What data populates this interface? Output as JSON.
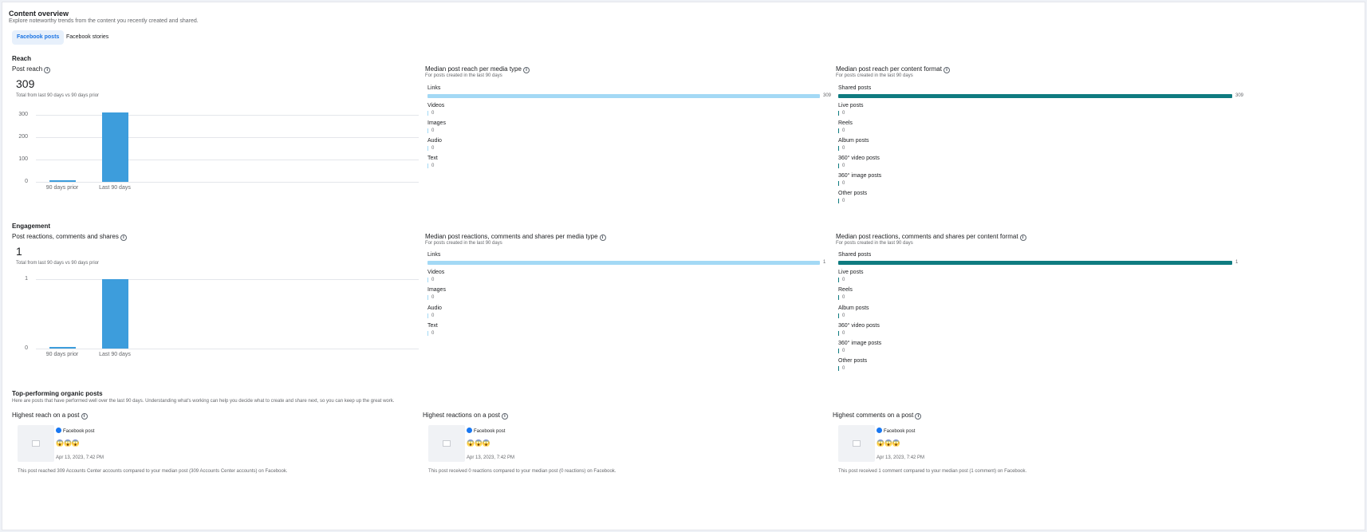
{
  "header": {
    "title": "Content overview",
    "subtitle": "Explore noteworthy trends from the content you recently created and shared."
  },
  "tabs": [
    {
      "label": "Facebook posts",
      "active": true
    },
    {
      "label": "Facebook stories",
      "active": false
    }
  ],
  "reach": {
    "section_title": "Reach",
    "post_reach": {
      "title": "Post reach",
      "total": "309",
      "caption": "Total from last 90 days vs 90 days prior",
      "chart_data": {
        "type": "bar",
        "categories": [
          "90 days prior",
          "Last 90 days"
        ],
        "values": [
          4,
          309
        ],
        "ylim": [
          0,
          309
        ],
        "yticks": [
          "300",
          "200",
          "100",
          "0"
        ],
        "ytick_values": [
          300,
          200,
          100,
          0
        ],
        "color": "#3d9ddc"
      }
    },
    "media_type": {
      "title": "Median post reach per media type",
      "caption": "For posts created in the last 90 days",
      "chart_data": {
        "type": "bar",
        "color": "#a3d9f5",
        "max": 309,
        "categories": [
          "Links",
          "Videos",
          "Images",
          "Audio",
          "Text"
        ],
        "values": [
          309,
          0,
          0,
          0,
          0
        ],
        "value_labels": [
          "309",
          "0",
          "0",
          "0",
          "0"
        ]
      }
    },
    "content_format": {
      "title": "Median post reach per content format",
      "caption": "For posts created in the last 90 days",
      "chart_data": {
        "type": "bar",
        "color": "#0f7b80",
        "max": 309,
        "categories": [
          "Shared posts",
          "Live posts",
          "Reels",
          "Album posts",
          "360° video posts",
          "360° image posts",
          "Other posts"
        ],
        "values": [
          309,
          0,
          0,
          0,
          0,
          0,
          0
        ],
        "value_labels": [
          "309",
          "0",
          "0",
          "0",
          "0",
          "0",
          "0"
        ]
      }
    }
  },
  "engagement": {
    "section_title": "Engagement",
    "post_engagement": {
      "title": "Post reactions, comments and shares",
      "total": "1",
      "caption": "Total from last 90 days vs 90 days prior",
      "chart_data": {
        "type": "bar",
        "categories": [
          "90 days prior",
          "Last 90 days"
        ],
        "values": [
          0.02,
          1
        ],
        "ylim": [
          0,
          1
        ],
        "yticks": [
          "1",
          "0"
        ],
        "ytick_values": [
          1,
          0
        ],
        "color": "#3d9ddc"
      }
    },
    "media_type": {
      "title": "Median post reactions, comments and shares per media type",
      "caption": "For posts created in the last 90 days",
      "chart_data": {
        "type": "bar",
        "color": "#a3d9f5",
        "max": 1,
        "categories": [
          "Links",
          "Videos",
          "Images",
          "Audio",
          "Text"
        ],
        "values": [
          1,
          0,
          0,
          0,
          0
        ],
        "value_labels": [
          "1",
          "0",
          "0",
          "0",
          "0"
        ]
      }
    },
    "content_format": {
      "title": "Median post reactions, comments and shares per content format",
      "caption": "For posts created in the last 90 days",
      "chart_data": {
        "type": "bar",
        "color": "#0f7b80",
        "max": 1,
        "categories": [
          "Shared posts",
          "Live posts",
          "Reels",
          "Album posts",
          "360° video posts",
          "360° image posts",
          "Other posts"
        ],
        "values": [
          1,
          0,
          0,
          0,
          0,
          0,
          0
        ],
        "value_labels": [
          "1",
          "0",
          "0",
          "0",
          "0",
          "0",
          "0"
        ]
      }
    }
  },
  "top_posts": {
    "title": "Top-performing organic posts",
    "subtitle": "Here are posts that have performed well over the last 90 days. Understanding what's working can help you decide what to create and share next, so you can keep up the great work.",
    "cards": [
      {
        "title": "Highest reach on a post",
        "post_type": "Facebook post",
        "emoji": "😱😱😱",
        "date": "Apr 13, 2023, 7:42 PM",
        "description": "This post reached 309 Accounts Center accounts compared to your median post (309 Accounts Center accounts) on Facebook."
      },
      {
        "title": "Highest reactions on a post",
        "post_type": "Facebook post",
        "emoji": "😱😱😱",
        "date": "Apr 13, 2023, 7:42 PM",
        "description": "This post received 0 reactions compared to your median post (0 reactions) on Facebook."
      },
      {
        "title": "Highest comments on a post",
        "post_type": "Facebook post",
        "emoji": "😱😱😱",
        "date": "Apr 13, 2023, 7:42 PM",
        "description": "This post received 1 comment compared to your median post (1 comment) on Facebook."
      }
    ]
  },
  "icons": {
    "info": "info-icon",
    "facebook": "facebook-icon",
    "image_placeholder": "image-placeholder-icon"
  },
  "colors": {
    "accent": "#1b74e4",
    "tab_active_bg": "#e7f0fb",
    "column_bar": "#3d9ddc",
    "media_bar": "#a3d9f5",
    "format_bar": "#0f7b80"
  }
}
